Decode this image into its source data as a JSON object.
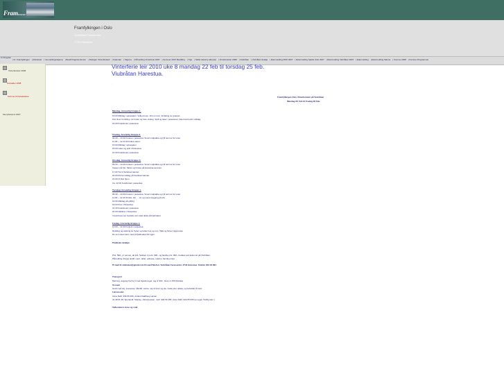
{
  "logo": {
    "text": "Fram....."
  },
  "header": {
    "org": "Framfylkingen i Oslo",
    "sub1": "Viubråtan Feriesenter",
    "sub2": "2743 Harestua"
  },
  "nav": {
    "home": "Fr Program",
    "links": [
      "Fr. Framfylkingen",
      "Aktiviteter",
      "Innmeldingsskjema",
      "Bestill Fagnavnkontor",
      "Deltager Vinterferieleir",
      "Kalender",
      "Skjema",
      "Påmelding Vinterferie 2007",
      "Sommer 2007 Bestilling",
      "Tipp",
      "Skifte tekst/ny allerede",
      "Vinterferieleir 2008",
      "Viubråtan",
      "Viubråtan detalje",
      "Ettermelding PRO 2007",
      "Ettermelding Sjælle Oslo 2007",
      "Ettermelding Viubråtan 2007",
      "Ettermelding",
      "Ettermelding Slanne",
      "Komme 2008",
      "Komme Programmet"
    ]
  },
  "sidebar": {
    "items": [
      "Vinterferieleir 2008",
      "Kontakter 2008",
      "Komme til Ferieledelse",
      "Menyliste/juni 2007"
    ]
  },
  "main": {
    "headline1": "Vinterferie leir 2010  uke 8  mandag 22 feb til torsdag 25 feb.",
    "headline2": "Viubråtan Harestua.",
    "dot": ".",
    "center1": "Framfylkingen Oslo Vinterferieleir på Viubråtan",
    "center2": "Mandag 22. Feb til Fredag 26 Feb.",
    "lines": [
      {
        "t": "Mandag, Ansvarlig Gruppe 1.",
        "cls": "b u"
      },
      {
        "t": "16.00        Middag i spisesalen. Velkommen. Info om leir. Inndeling av grupper."
      },
      {
        "t": "Fire timer til rafting i tur-hytter og fuss. Ankeg. Spill og leker i peisestua i hele kveld etter middag."
      },
      {
        "t": "21.00        Kveldsmat i peisestua."
      },
      {
        "t": "Tirsdag, Ansvarlig Gruppe 2.",
        "cls": "b u"
      },
      {
        "t": "09.30 -- 10.30            Frokost i peisestua. Smør matpakke og fyll termos for turen."
      },
      {
        "t": "11.30 -- ca 16.00  Felles utetur."
      },
      {
        "t": "16.00        Middag i spisesalen."
      },
      {
        "t": "18.00        Leker og spill i Peisestua."
      },
      {
        "t": "21.00        Kveldsmat i peisestua."
      },
      {
        "t": "Onsdag, Ansvarlig Gruppe 3.",
        "cls": "b u"
      },
      {
        "t": "09.30 -- 10.30            Frokost i peisestua. Smør matpakke og fyll termos for turen."
      },
      {
        "t": "                  Utetuer på Viu: Skitur og hinsse på Harestua sentrum."
      },
      {
        "t": "17.00        Tur til Solobservatoriet."
      },
      {
        "t": "20.00        Pizza middag på Solobservatoriet."
      },
      {
        "t": "21.00        Vi drar hjem."
      },
      {
        "t": "Ca. 22.00        Kveldsmat i peisestua."
      },
      {
        "t": "Torsdag, Ansvarlig Gruppe 4.",
        "cls": "b u"
      },
      {
        "t": "09.30 -- 10.30            Frokost i peisestua. Smør matpakke og fyll termos for turen."
      },
      {
        "t": "11.30 -- ca 16.00  Ake, lek, ... tur og Lavvo bygging på Viu."
      },
      {
        "t": "16.00        Middag på grilling"
      },
      {
        "t": "19.00        Kino i Peisestua."
      },
      {
        "t": "21.30        Kveldsmat i peisestua."
      },
      {
        "t": "22.00        Nattkino i Peisestua."
      },
      {
        "t": "I kveld kommer foreldre som skal delta på Fjellmøtet."
      },
      {
        "t": "Fredag, Ansvarlig Gruppe 1.",
        "cls": "b u"
      },
      {
        "t": "10.00 -- 11.00            Frokost i peisestua"
      },
      {
        "t": "Rydding og vasking av hytter og felles hus og rom. Takk og farvel. Hjemreise."
      },
      {
        "t": "De som skal være med på fjelltmøtet blir igjen."
      },
      {
        "t": "Praktiske detaljer.",
        "cls": "b"
      },
      {
        "t": "Pris: 590,- pr person, alt inkl. Søsken 2 pers: 990,- og familie pris: 990,- betales ved ankomst på Viubråtan."
      },
      {
        "t": "Påmelding (Oppgi antall, navn, alder, adresse, telefon, familie priser."
      },
      {
        "t": "Pr.mail til viubratan@gmail.com    Posten/Telefon:  Viubråtan Feriesenter, 2743 Harestua. Telefon 613 23 891",
        "cls": "b"
      },
      {
        "t": "Transport",
        "cls": "b"
      },
      {
        "t": "Med tog, avgang fra fra 4 med Gjøvik-toget; tog nr 900 , buss nr 150 (Dokka)"
      },
      {
        "t": "Ta med:",
        "cls": "b"
      },
      {
        "t": "Godt med tøy, sovepose, håndkl. varme, tøy til turer og ute. Gode sko, skitøy, og beholder til turer."
      },
      {
        "t": "Lærsnesde:",
        "cls": "b"
      },
      {
        "t": "Anne Dahl, 936 65 666, Anders Rødberg Larsen"
      },
      {
        "t": "41 48 01 48, Sperandli: Stanley, Johannessen, mob. 906 56 465, Anne Dahl, 934 65 666 (en egen frivillig anm.)"
      },
      {
        "t": "Velkommen store og små",
        "cls": "b"
      }
    ]
  }
}
